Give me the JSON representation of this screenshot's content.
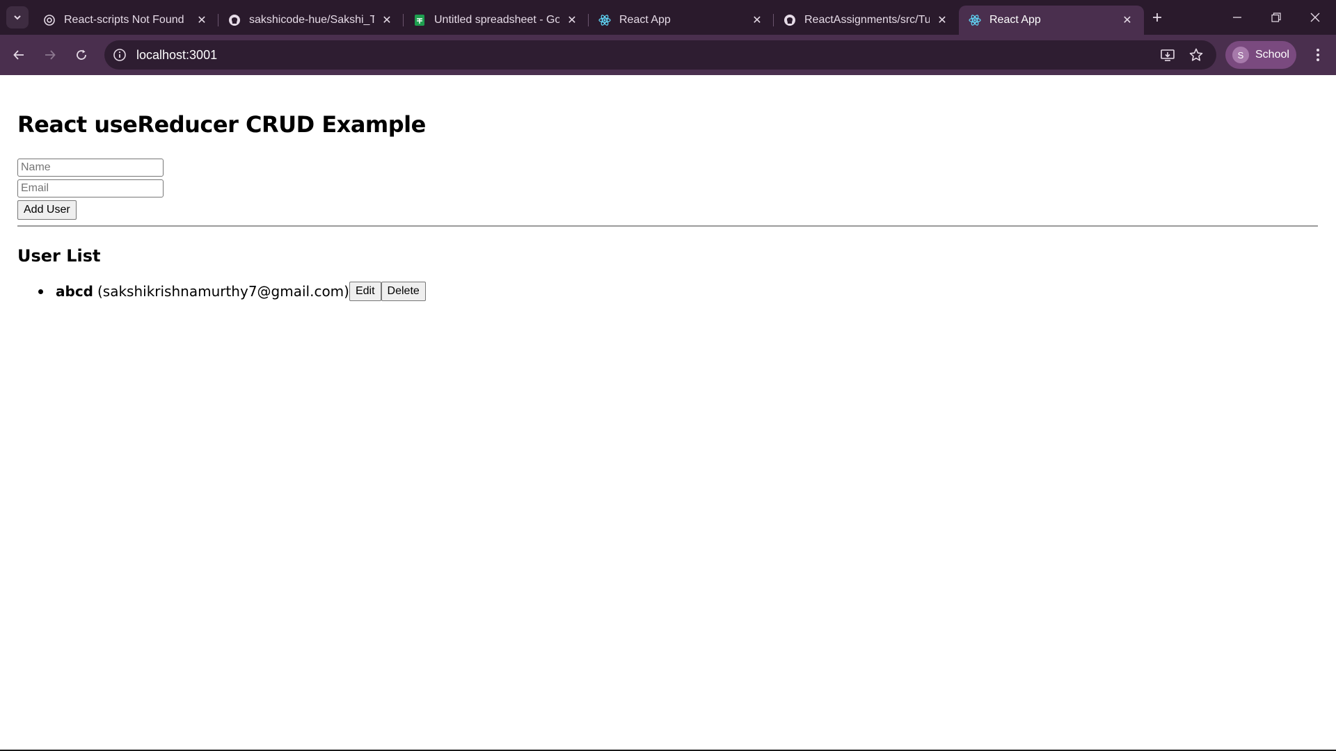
{
  "browser": {
    "tabs": [
      {
        "title": "React-scripts Not Found",
        "icon": "chatgpt-icon",
        "active": false
      },
      {
        "title": "sakshicode-hue/Sakshi_Tea",
        "icon": "github-icon",
        "active": false
      },
      {
        "title": "Untitled spreadsheet - Goo",
        "icon": "sheets-icon",
        "active": false
      },
      {
        "title": "React App",
        "icon": "react-icon",
        "active": false
      },
      {
        "title": "ReactAssignments/src/Tuto",
        "icon": "github-icon",
        "active": false
      },
      {
        "title": "React App",
        "icon": "react-icon",
        "active": true
      }
    ],
    "url": "localhost:3001",
    "profile_initial": "S",
    "profile_label": "School",
    "accent_color": "#4a2f4e"
  },
  "app": {
    "title": "React useReducer CRUD Example",
    "name_placeholder": "Name",
    "email_placeholder": "Email",
    "add_button": "Add User",
    "list_heading": "User List",
    "users": [
      {
        "name": "abcd",
        "email": "(sakshikrishnamurthy7@gmail.com)",
        "edit_label": "Edit",
        "delete_label": "Delete"
      }
    ]
  }
}
